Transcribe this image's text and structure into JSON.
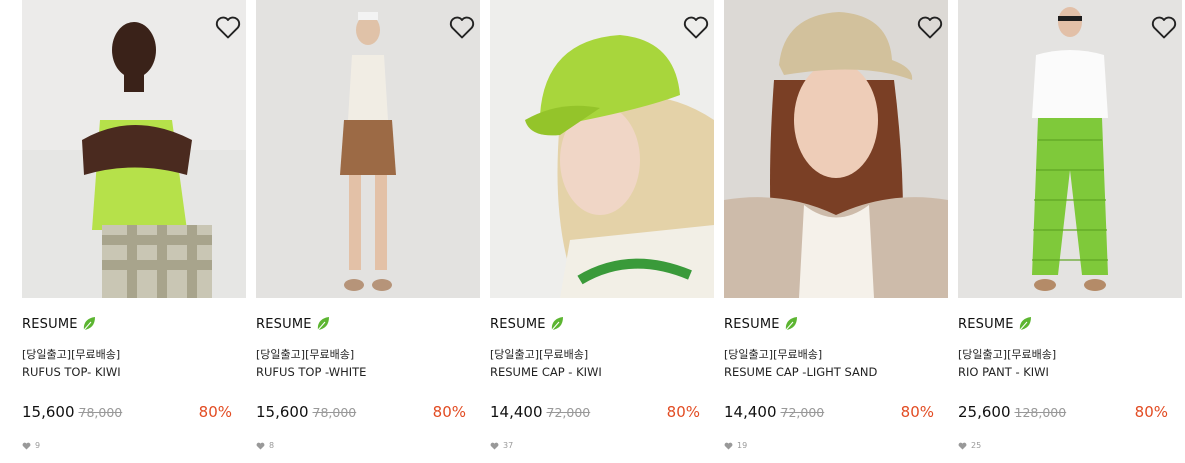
{
  "products": [
    {
      "brand": "RESUME",
      "tagline": "[당일출고][무료배송]",
      "name": "RUFUS TOP- KIWI",
      "price": "15,600",
      "original_price": "78,000",
      "discount": "80%",
      "likes": "9",
      "image_icon": "model-photo"
    },
    {
      "brand": "RESUME",
      "tagline": "[당일출고][무료배송]",
      "name": "RUFUS TOP -WHITE",
      "price": "15,600",
      "original_price": "78,000",
      "discount": "80%",
      "likes": "8",
      "image_icon": "model-photo"
    },
    {
      "brand": "RESUME",
      "tagline": "[당일출고][무료배송]",
      "name": "RESUME CAP - KIWI",
      "price": "14,400",
      "original_price": "72,000",
      "discount": "80%",
      "likes": "37",
      "image_icon": "model-photo"
    },
    {
      "brand": "RESUME",
      "tagline": "[당일출고][무료배송]",
      "name": "RESUME CAP -LIGHT SAND",
      "price": "14,400",
      "original_price": "72,000",
      "discount": "80%",
      "likes": "19",
      "image_icon": "model-photo"
    },
    {
      "brand": "RESUME",
      "tagline": "[당일출고][무료배송]",
      "name": "RIO PANT - KIWI",
      "price": "25,600",
      "original_price": "128,000",
      "discount": "80%",
      "likes": "25",
      "image_icon": "model-photo"
    }
  ],
  "colors": {
    "discount": "#e24c23",
    "leaf": "#5cb531",
    "muted": "#999999",
    "text": "#222222"
  },
  "icons": {
    "wishlist": "heart-outline-icon",
    "eco": "leaf-icon",
    "likes": "heart-filled-icon"
  }
}
